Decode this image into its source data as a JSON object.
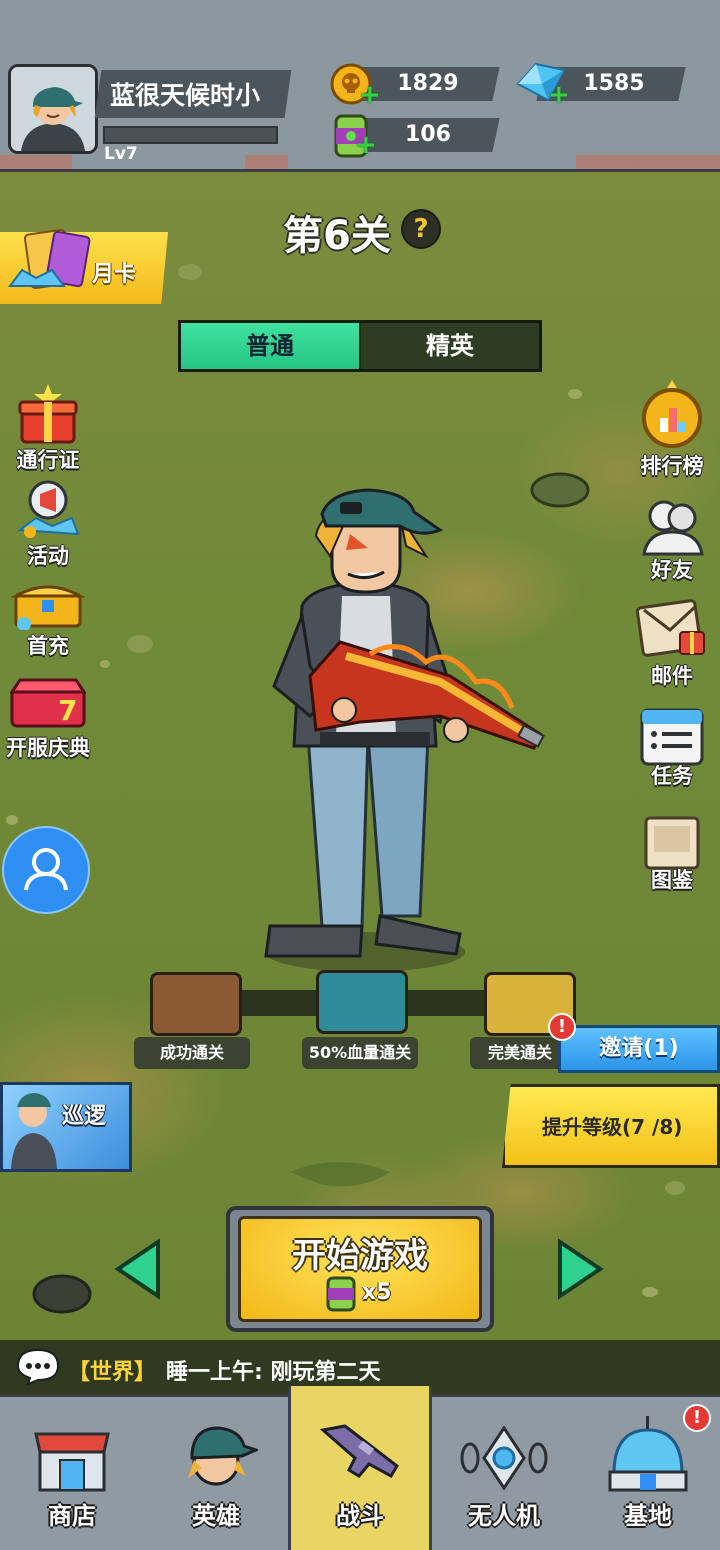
{
  "player": {
    "name": "蓝很天候时小",
    "level": "Lv7",
    "xp_fraction": 0.0
  },
  "resources": {
    "coins": "1829",
    "gems": "1585",
    "energy": "106"
  },
  "stage": {
    "title": "第6关",
    "help": "?",
    "tabs": [
      {
        "label": "普通",
        "active": true
      },
      {
        "label": "精英",
        "active": false
      }
    ]
  },
  "left_menu": {
    "month_card": "月卡",
    "items": [
      {
        "label": "通行证",
        "icon": "gift-box-icon"
      },
      {
        "label": "活动",
        "icon": "megaphone-icon"
      },
      {
        "label": "首充",
        "icon": "treasure-chest-icon"
      },
      {
        "label": "开服庆典",
        "icon": "celebration-box-icon"
      }
    ],
    "patrol": "巡逻"
  },
  "right_menu": {
    "items": [
      {
        "label": "排行榜",
        "icon": "trophy-icon"
      },
      {
        "label": "好友",
        "icon": "friends-icon"
      },
      {
        "label": "邮件",
        "icon": "mail-icon"
      },
      {
        "label": "任务",
        "icon": "task-clipboard-icon"
      },
      {
        "label": "图鉴",
        "icon": "codex-book-icon"
      }
    ]
  },
  "rewards": {
    "chests": [
      {
        "label": "成功通关",
        "color": "#8a5a35"
      },
      {
        "label": "50%血量通关",
        "color": "#2f8a9a"
      },
      {
        "label": "完美通关",
        "color": "#d8b23a"
      }
    ]
  },
  "actions": {
    "invite": "邀请(1)",
    "invite_badge": "!",
    "level_up": "提升等级(7 /8)",
    "start_game": "开始游戏",
    "start_cost": "x5"
  },
  "chat": {
    "channel": "【世界】",
    "message": "睡一上午: 刚玩第二天"
  },
  "bottom_nav": {
    "items": [
      {
        "label": "商店",
        "icon": "shop-icon"
      },
      {
        "label": "英雄",
        "icon": "hero-icon"
      },
      {
        "label": "战斗",
        "icon": "rifle-icon",
        "active": true
      },
      {
        "label": "无人机",
        "icon": "drone-icon"
      },
      {
        "label": "基地",
        "icon": "base-dome-icon"
      }
    ],
    "base_badge": "!"
  },
  "colors": {
    "accent_green": "#2fd18e",
    "accent_yellow": "#f4c119",
    "accent_blue": "#2a94e8",
    "badge_red": "#e53935"
  }
}
